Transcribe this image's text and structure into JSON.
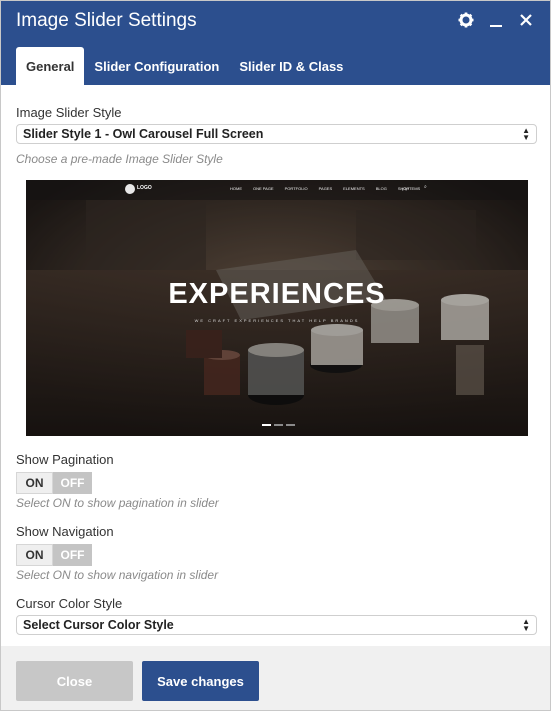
{
  "dialog": {
    "title": "Image Slider Settings",
    "icons": [
      "gear-icon",
      "minimize-icon",
      "close-icon"
    ]
  },
  "tabs": [
    {
      "label": "General",
      "active": true
    },
    {
      "label": "Slider Configuration",
      "active": false
    },
    {
      "label": "Slider ID & Class",
      "active": false
    }
  ],
  "style_field": {
    "label": "Image Slider Style",
    "selected": "Slider Style 1 - Owl Carousel Full Screen",
    "hint": "Choose a pre-made Image Slider Style"
  },
  "preview": {
    "logo": "LOGO",
    "nav": [
      "HOME",
      "ONE PAGE",
      "PORTFOLIO",
      "PAGES",
      "ELEMENTS",
      "BLOG",
      "SHOP"
    ],
    "cart": "(0) ITEMS",
    "heading": "EXPERIENCES",
    "subheading": "WE CRAFT EXPERIENCES THAT HELP BRANDS",
    "active_dot": 1
  },
  "pagination": {
    "label": "Show Pagination",
    "on": "ON",
    "off": "OFF",
    "hint": "Select ON to show pagination in slider"
  },
  "navigation": {
    "label": "Show Navigation",
    "on": "ON",
    "off": "OFF",
    "hint": "Select ON to show navigation in slider"
  },
  "cursor": {
    "label": "Cursor Color Style",
    "selected": "Select Cursor Color Style"
  },
  "footer": {
    "close_label": "Close",
    "save_label": "Save changes"
  },
  "colors": {
    "brand": "#2c4f8e",
    "close_button": "#c7c7c7",
    "footer_bg": "#f0f0f0"
  }
}
